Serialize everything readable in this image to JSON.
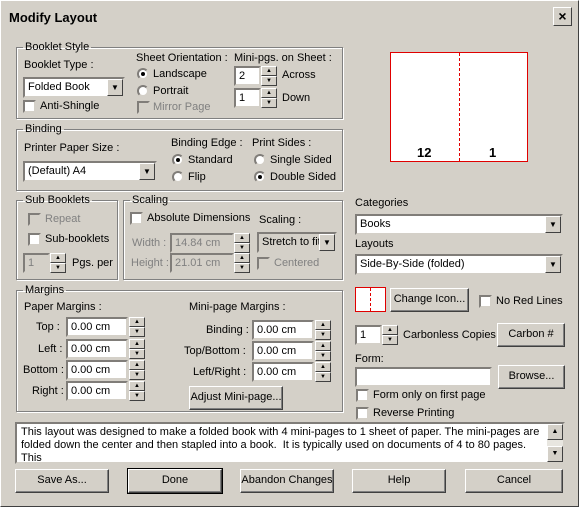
{
  "window": {
    "title": "Modify Layout",
    "close": "×"
  },
  "booklet_style": {
    "legend": "Booklet Style",
    "type_label": "Booklet Type :",
    "type_value": "Folded Book",
    "anti_shingle": "Anti-Shingle",
    "orientation_label": "Sheet Orientation :",
    "landscape": "Landscape",
    "portrait": "Portrait",
    "mirror_page": "Mirror Page",
    "minipgs_label": "Mini-pgs. on Sheet :",
    "across_value": "2",
    "across_label": "Across",
    "down_value": "1",
    "down_label": "Down"
  },
  "binding": {
    "legend": "Binding",
    "paper_size_label": "Printer Paper Size :",
    "paper_size_value": "(Default) A4",
    "edge_label": "Binding Edge :",
    "standard": "Standard",
    "flip": "Flip",
    "sides_label": "Print Sides :",
    "single": "Single Sided",
    "double": "Double Sided"
  },
  "sub_booklets": {
    "legend": "Sub Booklets",
    "repeat": "Repeat",
    "sub_booklets": "Sub-booklets",
    "pgs_value": "1",
    "pgs_label": "Pgs. per"
  },
  "scaling": {
    "legend": "Scaling",
    "absolute": "Absolute Dimensions",
    "scaling_label": "Scaling :",
    "scaling_value": "Stretch to fit",
    "width_label": "Width :",
    "width_value": "14.84 cm",
    "height_label": "Height :",
    "height_value": "21.01 cm",
    "centered": "Centered"
  },
  "margins": {
    "legend": "Margins",
    "paper_label": "Paper Margins :",
    "top_label": "Top :",
    "top_value": "0.00 cm",
    "left_label": "Left :",
    "left_value": "0.00 cm",
    "bottom_label": "Bottom :",
    "bottom_value": "0.00 cm",
    "right_label": "Right :",
    "right_value": "0.00 cm",
    "mini_label": "Mini-page Margins :",
    "binding_label": "Binding :",
    "binding_value": "0.00 cm",
    "topbottom_label": "Top/Bottom :",
    "topbottom_value": "0.00 cm",
    "leftright_label": "Left/Right :",
    "leftright_value": "0.00 cm",
    "adjust_button": "Adjust Mini-page..."
  },
  "preview": {
    "left_page": "12",
    "right_page": "1"
  },
  "right": {
    "categories_label": "Categories",
    "categories_value": "Books",
    "layouts_label": "Layouts",
    "layouts_value": "Side-By-Side (folded)",
    "change_icon": "Change Icon...",
    "no_red_lines": "No Red Lines",
    "carbonless_value": "1",
    "carbonless_label": "Carbonless Copies",
    "carbon_button": "Carbon #",
    "form_label": "Form:",
    "form_value": "",
    "browse": "Browse...",
    "form_first": "Form only on first page",
    "reverse": "Reverse Printing"
  },
  "description": "This layout was designed to make a folded book with 4 mini-pages to 1 sheet of paper. The mini-pages are folded down the center and then stapled into a book.  It is typically used on documents of 4 to 80 pages.  This",
  "buttons": {
    "save_as": "Save As...",
    "done": "Done",
    "abandon": "Abandon Changes",
    "help": "Help",
    "cancel": "Cancel"
  }
}
